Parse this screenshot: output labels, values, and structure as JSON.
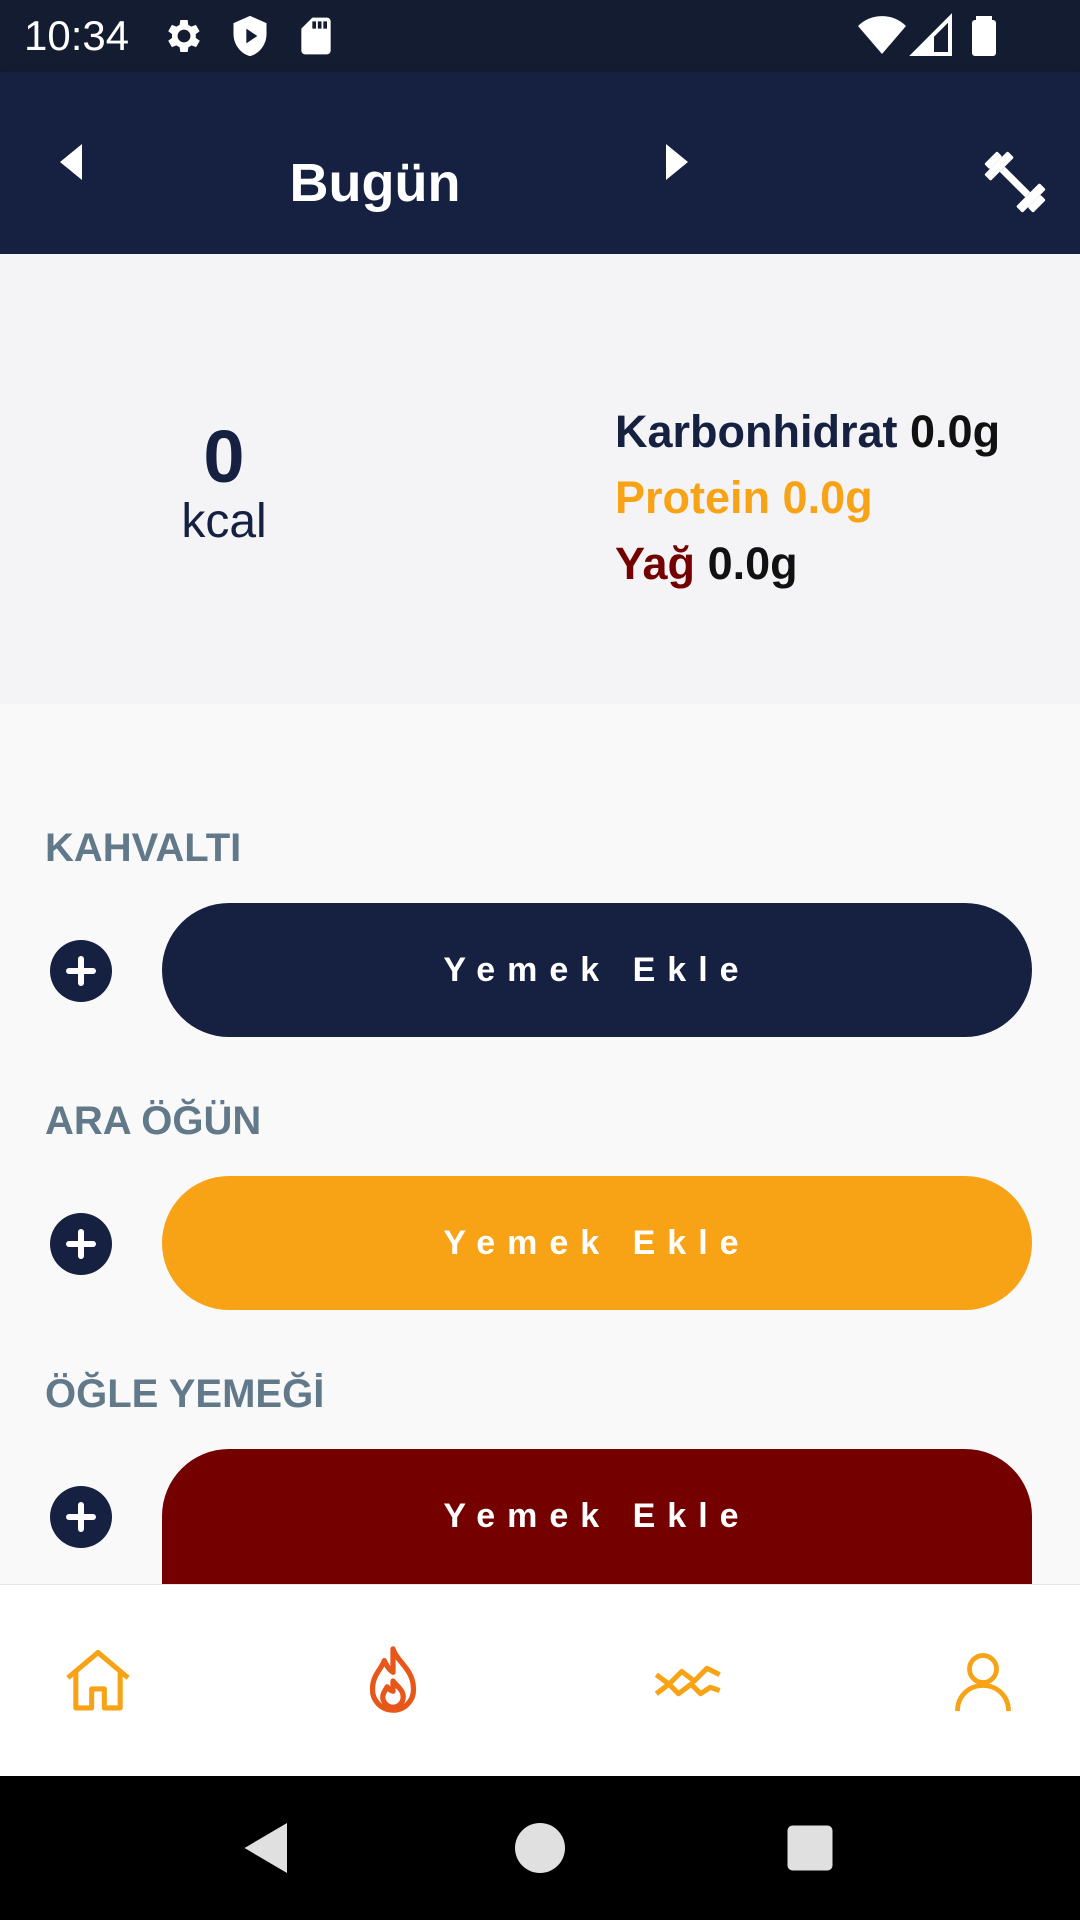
{
  "status_bar": {
    "time": "10:34",
    "icons_left": [
      "gear-icon",
      "shield-play-icon",
      "sd-card-icon"
    ],
    "icons_right": [
      "wifi-icon",
      "signal-icon",
      "battery-icon"
    ]
  },
  "app_bar": {
    "title": "Bugün",
    "prev_icon": "chevron-left-icon",
    "next_icon": "chevron-right-icon",
    "action_icon": "dumbbell-icon"
  },
  "summary": {
    "kcal_value": "0",
    "kcal_unit": "kcal",
    "carb_label": "Karbonhidrat",
    "carb_value": "0.0g",
    "protein_label": "Protein",
    "protein_value": "0.0g",
    "fat_label": "Yağ",
    "fat_value": "0.0g"
  },
  "meals": [
    {
      "title": "KAHVALTI",
      "button_label": "Yemek Ekle",
      "color": "#162040"
    },
    {
      "title": "ARA ÖĞÜN",
      "button_label": "Yemek Ekle",
      "color": "#f8a215"
    },
    {
      "title": "ÖĞLE YEMEĞİ",
      "button_label": "Yemek Ekle",
      "color": "#740000"
    }
  ],
  "bottom_nav": {
    "tabs": [
      "home-icon",
      "flame-icon",
      "chart-icon",
      "profile-icon"
    ],
    "accent": "#f8a215",
    "active_color": "#e8571a"
  },
  "colors": {
    "navy": "#162040",
    "orange": "#f8a215",
    "maroon": "#740000",
    "section_title": "#62798a"
  }
}
